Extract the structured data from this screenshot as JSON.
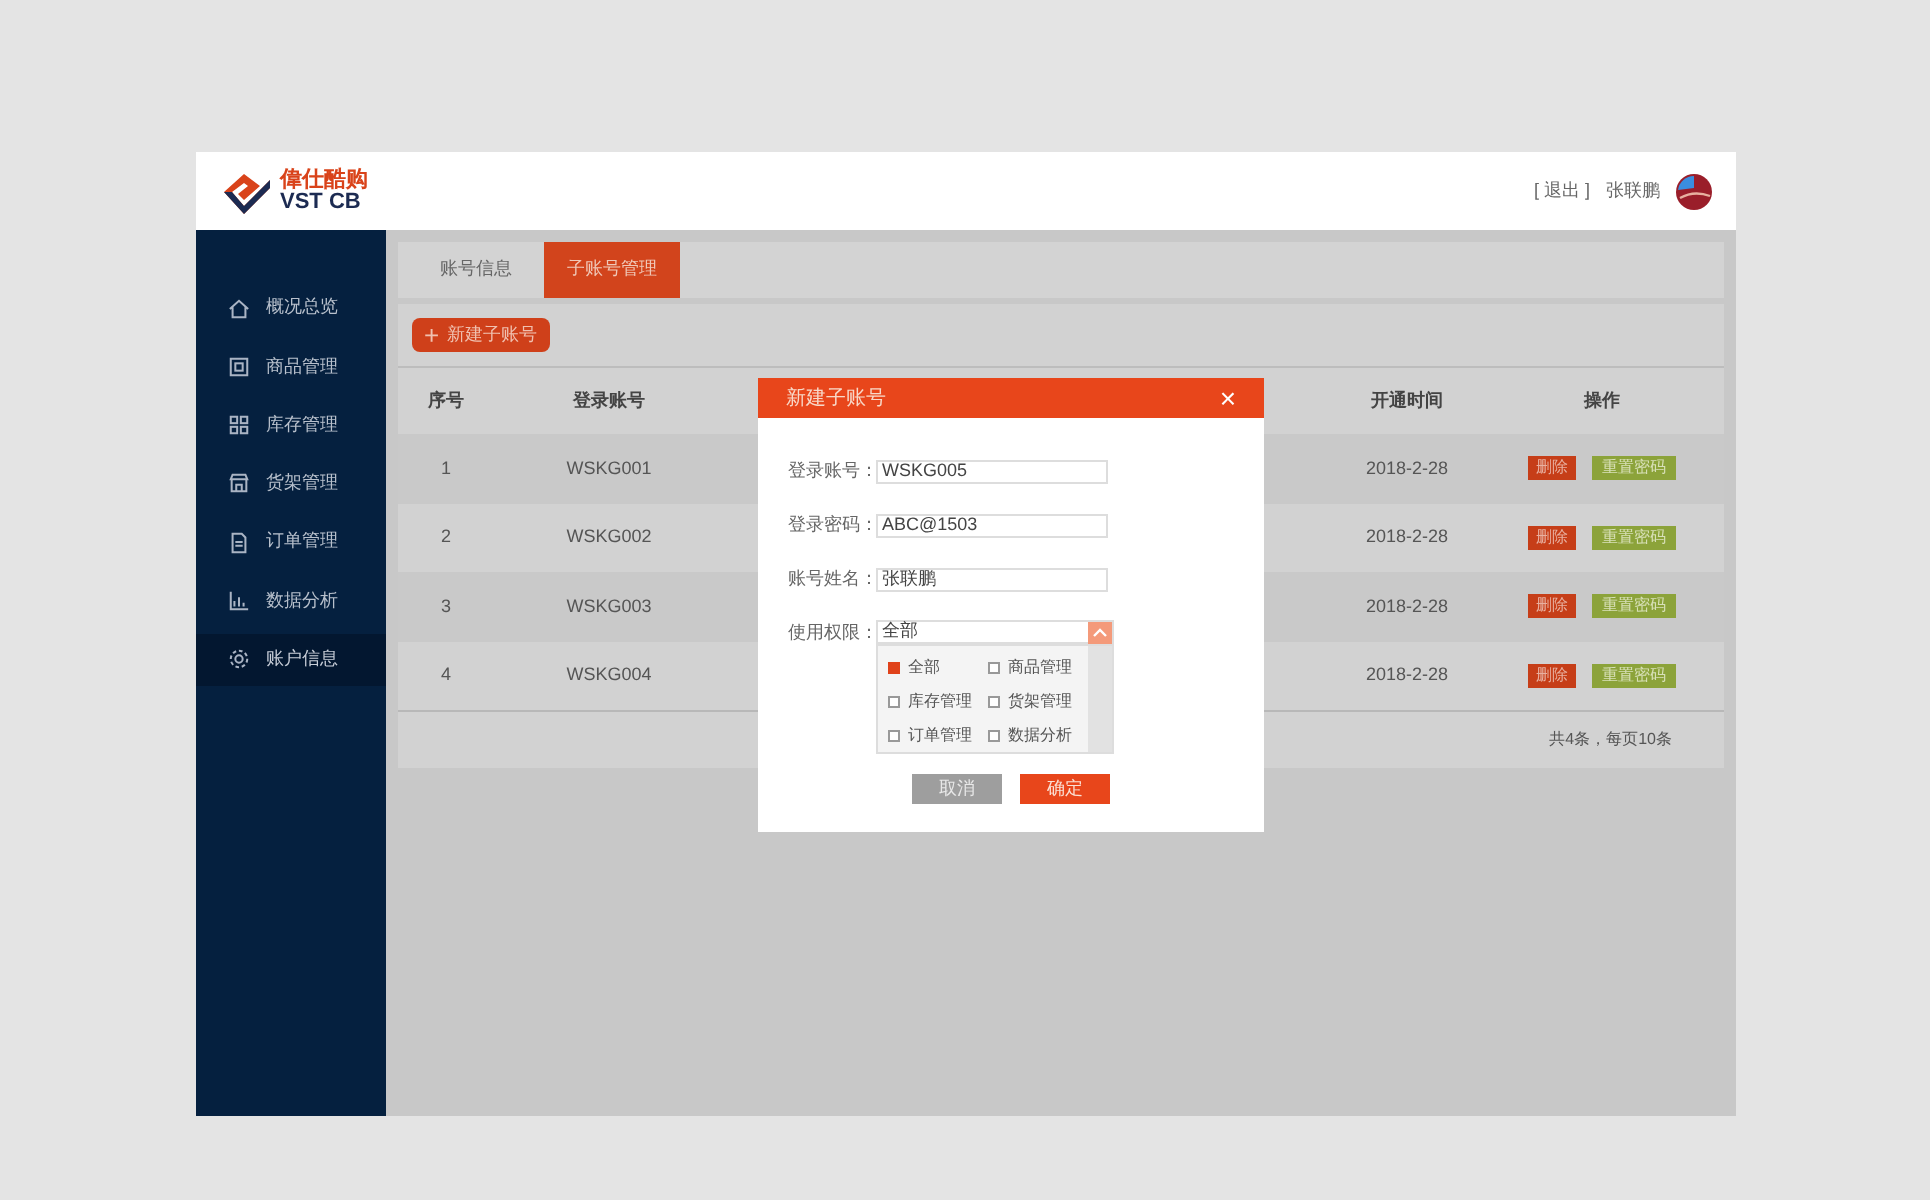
{
  "logo": {
    "name": "偉仕酷购",
    "sub": "VST CB"
  },
  "header": {
    "logout": "[ 退出 ]",
    "user": "张联鹏"
  },
  "sidebar": {
    "items": [
      {
        "label": "概况总览",
        "kind": "home",
        "selected": false
      },
      {
        "label": "商品管理",
        "kind": "box",
        "selected": false
      },
      {
        "label": "库存管理",
        "kind": "grid",
        "selected": false
      },
      {
        "label": "货架管理",
        "kind": "shop",
        "selected": false
      },
      {
        "label": "订单管理",
        "kind": "doc",
        "selected": false
      },
      {
        "label": "数据分析",
        "kind": "chart",
        "selected": false
      },
      {
        "label": "账户信息",
        "kind": "gear",
        "selected": true
      }
    ]
  },
  "tabs": [
    {
      "label": "账号信息",
      "selected": false
    },
    {
      "label": "子账号管理",
      "selected": true
    }
  ],
  "new_button": {
    "icon": "+",
    "label": "新建子账号"
  },
  "table": {
    "columns": [
      "序号",
      "登录账号",
      "开通时间",
      "操作"
    ],
    "rows": [
      {
        "index": "1",
        "account": "WSKG001",
        "date": "2018-2-28",
        "actions": [
          "删除",
          "重置密码"
        ]
      },
      {
        "index": "2",
        "account": "WSKG002",
        "date": "2018-2-28",
        "actions": [
          "删除",
          "重置密码"
        ]
      },
      {
        "index": "3",
        "account": "WSKG003",
        "date": "2018-2-28",
        "actions": [
          "删除",
          "重置密码"
        ]
      },
      {
        "index": "4",
        "account": "WSKG004",
        "date": "2018-2-28",
        "actions": [
          "删除",
          "重置密码"
        ]
      }
    ],
    "footer": "共4条，每页10条"
  },
  "dialog": {
    "title": "新建子账号",
    "close": "×",
    "fields": [
      {
        "label": "登录账号：",
        "value": "WSKG005"
      },
      {
        "label": "登录密码：",
        "value": "ABC@1503"
      },
      {
        "label": "账号姓名：",
        "value": "张联鹏"
      }
    ],
    "permission": {
      "label": "使用权限：",
      "value": "全部",
      "expanded": true,
      "options": [
        {
          "label": "全部",
          "checked": true
        },
        {
          "label": "商品管理",
          "checked": false
        },
        {
          "label": "库存管理",
          "checked": false
        },
        {
          "label": "货架管理",
          "checked": false
        },
        {
          "label": "订单管理",
          "checked": false
        },
        {
          "label": "数据分析",
          "checked": false
        }
      ]
    },
    "buttons": [
      {
        "label": "取消",
        "kind": "cancel"
      },
      {
        "label": "确定",
        "kind": "confirm"
      }
    ]
  }
}
